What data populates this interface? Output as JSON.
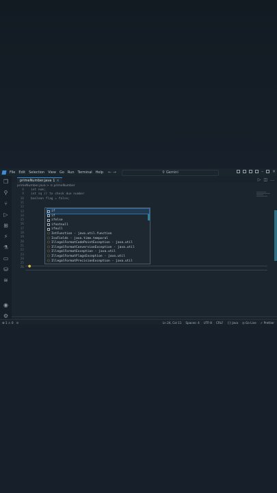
{
  "titlebar": {
    "menus": [
      "File",
      "Edit",
      "Selection",
      "View",
      "Go",
      "Run",
      "Terminal",
      "Help"
    ],
    "nav_arrows": "←  →",
    "search_text": "Gemini"
  },
  "tab": {
    "filename": "primeNumber.java",
    "dirty": "1",
    "close": "×"
  },
  "breadcrumb": "primeNumber.java > ⊙ primeNumber",
  "editor": {
    "line_numbers": [
      "8",
      "9",
      "10",
      "11",
      "12",
      "13",
      "14",
      "15",
      "16",
      "17",
      "18",
      "19",
      "20",
      "21",
      "22",
      "23",
      "24",
      "25",
      "26"
    ],
    "code_lines": [
      "int num;",
      "int sq // to check due number",
      "boolean flag = false;"
    ]
  },
  "suggestions": [
    {
      "label": "if",
      "kind": "keyword"
    },
    {
      "label": "if",
      "kind": "keyword"
    },
    {
      "label": "ifelse",
      "kind": "snippet"
    },
    {
      "label": "ifnotnull",
      "kind": "snippet"
    },
    {
      "label": "ifnull",
      "kind": "snippet"
    },
    {
      "label": "IntFunction - java.util.function",
      "kind": "class"
    },
    {
      "label": "IsoFields - java.time.temporal",
      "kind": "class"
    },
    {
      "label": "IllegalFormatCodePointException - java.util",
      "kind": "class"
    },
    {
      "label": "IllegalFormatConversionException - java.util",
      "kind": "class"
    },
    {
      "label": "IllegalFormatException - java.util",
      "kind": "class"
    },
    {
      "label": "IllegalFormatFlagsException - java.util",
      "kind": "class"
    },
    {
      "label": "IllegalFormatPrecisionException - java.util",
      "kind": "class"
    }
  ],
  "statusbar": {
    "left": [
      "⊗ 1 ⚠ 0",
      "⊙"
    ],
    "right": [
      "Ln 24, Col 11",
      "Spaces: 4",
      "UTF-8",
      "CRLF",
      "{} Java",
      "◎ Go Live",
      "✓ Prettier"
    ]
  },
  "colors": {
    "accent": "#3a8dd8",
    "background": "#17202a",
    "editor_bg": "#1b252e",
    "lightbulb": "#e3c34c"
  }
}
